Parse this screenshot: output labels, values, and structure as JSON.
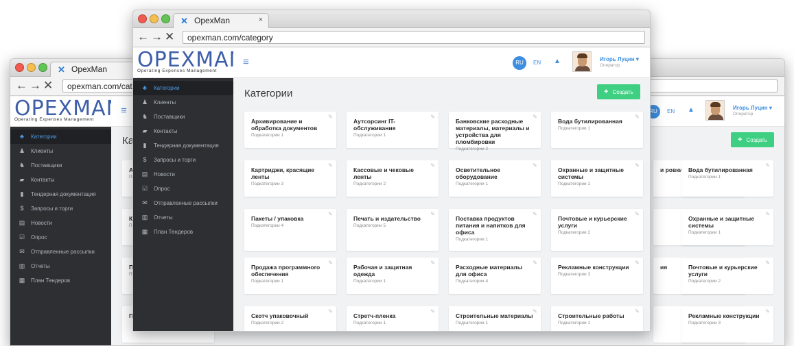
{
  "browser": {
    "tab_title": "OpexMan",
    "tab_close": "×",
    "url": "opexman.com/category",
    "url_back_truncated": "opexman.com/categor",
    "nav_back": "←",
    "nav_forward": "→",
    "nav_stop": "✕"
  },
  "logo": {
    "text": "OPEXMAN",
    "subtitle": "Operating Expenses Management"
  },
  "topbar": {
    "menu_icon": "≡",
    "lang_ru": "RU",
    "lang_en": "EN",
    "bell_icon": "🔔",
    "user_name": "Игорь Луцин",
    "user_role": "Оператор",
    "user_caret": "▾"
  },
  "sidebar": {
    "items": [
      {
        "label": "Категории",
        "icon": "sitemap-icon",
        "glyph": "♣",
        "active": true
      },
      {
        "label": "Клиенты",
        "icon": "user-icon",
        "glyph": "♟"
      },
      {
        "label": "Поставщики",
        "icon": "users-icon",
        "glyph": "♞"
      },
      {
        "label": "Контакты",
        "icon": "book-icon",
        "glyph": "▰"
      },
      {
        "label": "Тендерная документация",
        "icon": "file-icon",
        "glyph": "▮"
      },
      {
        "label": "Запросы и торги",
        "icon": "dollar-icon",
        "glyph": "$"
      },
      {
        "label": "Новости",
        "icon": "newspaper-icon",
        "glyph": "▤"
      },
      {
        "label": "Опрос",
        "icon": "check-square-icon",
        "glyph": "☑"
      },
      {
        "label": "Отправленные рассылки",
        "icon": "envelope-icon",
        "glyph": "✉"
      },
      {
        "label": "Отчеты",
        "icon": "bar-chart-icon",
        "glyph": "▥"
      },
      {
        "label": "План Тендеров",
        "icon": "calendar-icon",
        "glyph": "▦"
      }
    ]
  },
  "main": {
    "title": "Категории",
    "title_back_truncated": "Ка",
    "create_plus": "+",
    "create_label": "Создать",
    "edit_glyph": "✎"
  },
  "categories": [
    {
      "name": "Архивирование и обработка документов",
      "sub": "Подкатегории 1"
    },
    {
      "name": "Аутсорсинг IT-обслуживания",
      "sub": "Подкатегории 1"
    },
    {
      "name": "Банковские расходные материалы, материалы и устройства для пломбировки",
      "sub": "Подкатегории 2"
    },
    {
      "name": "Вода бутилированная",
      "sub": "Подкатегории 1"
    },
    {
      "name": "Картриджи, красящие ленты",
      "sub": "Подкатегории 3"
    },
    {
      "name": "Кассовые и чековые ленты",
      "sub": "Подкатегории 2"
    },
    {
      "name": "Осветительное оборудование",
      "sub": "Подкатегории 1"
    },
    {
      "name": "Охранные и защитные системы",
      "sub": "Подкатегории 1"
    },
    {
      "name": "Пакеты / упаковка",
      "sub": "Подкатегории 4"
    },
    {
      "name": "Печать и издательство",
      "sub": "Подкатегории 5"
    },
    {
      "name": "Поставка продуктов питания и напитков для офиса",
      "sub": "Подкатегории 1"
    },
    {
      "name": "Почтовые и курьерские услуги",
      "sub": "Подкатегории 2"
    },
    {
      "name": "Продажа программного обеспечения",
      "sub": "Подкатегории 1"
    },
    {
      "name": "Рабочая и защитная одежда",
      "sub": "Подкатегории 1"
    },
    {
      "name": "Расходные материалы для офиса",
      "sub": "Подкатегории 4"
    },
    {
      "name": "Рекламные конструкции",
      "sub": "Подкатегории 3"
    },
    {
      "name": "Скотч упаковочный",
      "sub": "Подкатегории 2"
    },
    {
      "name": "Стретч-пленка",
      "sub": "Подкатегории 1"
    },
    {
      "name": "Строительные материалы",
      "sub": "Подкатегории 1"
    },
    {
      "name": "Строительные работы",
      "sub": "Подкатегории 1"
    }
  ],
  "back_cards_left": [
    {
      "name": "Ар",
      "sub": "По"
    },
    {
      "name": "Ка ле",
      "sub": "По"
    },
    {
      "name": "Па",
      "sub": "По"
    },
    {
      "name": "Пр об",
      "sub": ""
    }
  ],
  "back_cards_right": [
    {
      "name": "Вода бутилированная",
      "sub": "Подкатегории 1",
      "stub": "и ровки"
    },
    {
      "name": "Охранные и защитные системы",
      "sub": "Подкатегории 1",
      "stub": ""
    },
    {
      "name": "Почтовые и курьерские услуги",
      "sub": "Подкатегории 2",
      "stub": "ия"
    },
    {
      "name": "Рекламные конструкции",
      "sub": "Подкатегории 3",
      "stub": ""
    }
  ]
}
